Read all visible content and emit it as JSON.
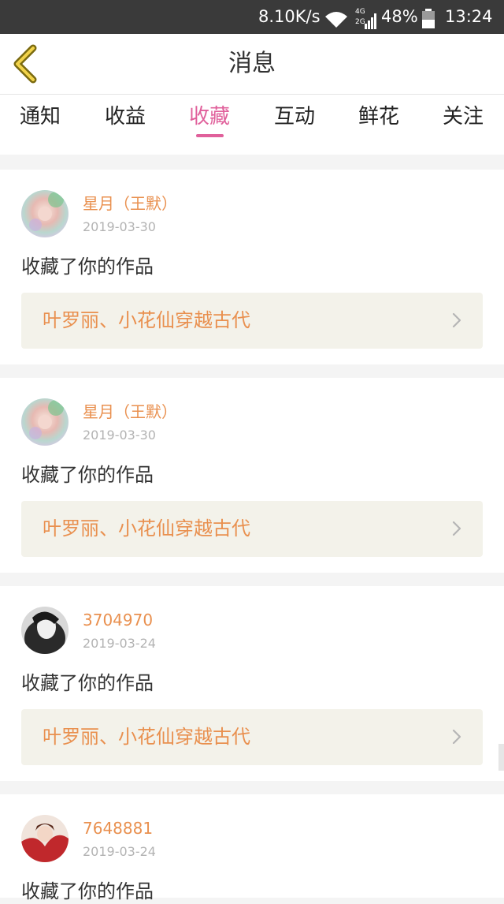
{
  "status_bar": {
    "network_speed": "8.10K/s",
    "network_type_top": "4G",
    "network_type_bottom": "2G",
    "battery": "48%",
    "time": "13:24"
  },
  "header": {
    "title": "消息"
  },
  "tabs": [
    {
      "label": "通知"
    },
    {
      "label": "收益"
    },
    {
      "label": "收藏"
    },
    {
      "label": "互动"
    },
    {
      "label": "鲜花"
    },
    {
      "label": "关注"
    }
  ],
  "active_tab": "收藏",
  "colors": {
    "accent": "#e0609b",
    "username": "#e9904f",
    "status_bar": "#3a3a3a"
  },
  "messages": [
    {
      "username": "星月（王默）",
      "date": "2019-03-30",
      "action": "收藏了你的作品",
      "work_title": "叶罗丽、小花仙穿越古代"
    },
    {
      "username": "星月（王默）",
      "date": "2019-03-30",
      "action": "收藏了你的作品",
      "work_title": "叶罗丽、小花仙穿越古代"
    },
    {
      "username": "3704970",
      "date": "2019-03-24",
      "action": "收藏了你的作品",
      "work_title": "叶罗丽、小花仙穿越古代"
    },
    {
      "username": "7648881",
      "date": "2019-03-24",
      "action": "收藏了你的作品",
      "work_title": ""
    }
  ]
}
